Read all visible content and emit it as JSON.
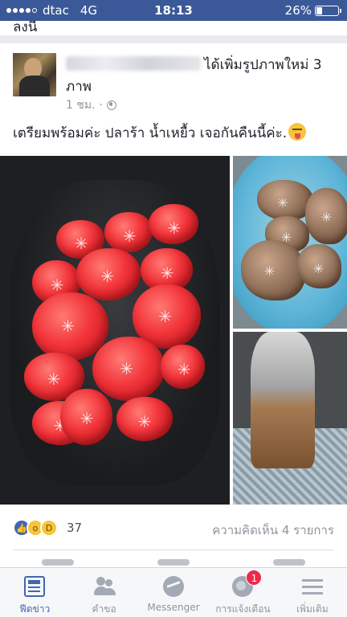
{
  "status_bar": {
    "carrier": "dtac",
    "network": "4G",
    "time": "18:13",
    "battery": "26%",
    "battery_level": 0.26
  },
  "previous_post": {
    "tail_text": "ลงนี"
  },
  "post": {
    "action_line1": "ได้เพิ่มรูปภาพใหม่ 3",
    "action_line2": "ภาพ",
    "time": "1 ชม.",
    "separator": "·",
    "text": "เตรียมพร้อมค่ะ ปลาร้า น้ำเหยื้ว เจอกันคืนนี้ค่ะ.",
    "reaction_count": "37",
    "comments": "ความคิดเห็น 4 รายการ"
  },
  "tab_bar": {
    "tabs": [
      {
        "label": "ฟีดข่าว",
        "icon": "news-feed-icon"
      },
      {
        "label": "คำขอ",
        "icon": "friends-icon"
      },
      {
        "label": "Messenger",
        "icon": "messenger-icon"
      },
      {
        "label": "การแจ้งเตือน",
        "icon": "globe-icon",
        "badge": "1"
      },
      {
        "label": "เพิ่มเติม",
        "icon": "menu-icon"
      }
    ]
  },
  "colors": {
    "brand": "#3b5998",
    "accent": "#4267b2",
    "badge": "#f02849"
  }
}
